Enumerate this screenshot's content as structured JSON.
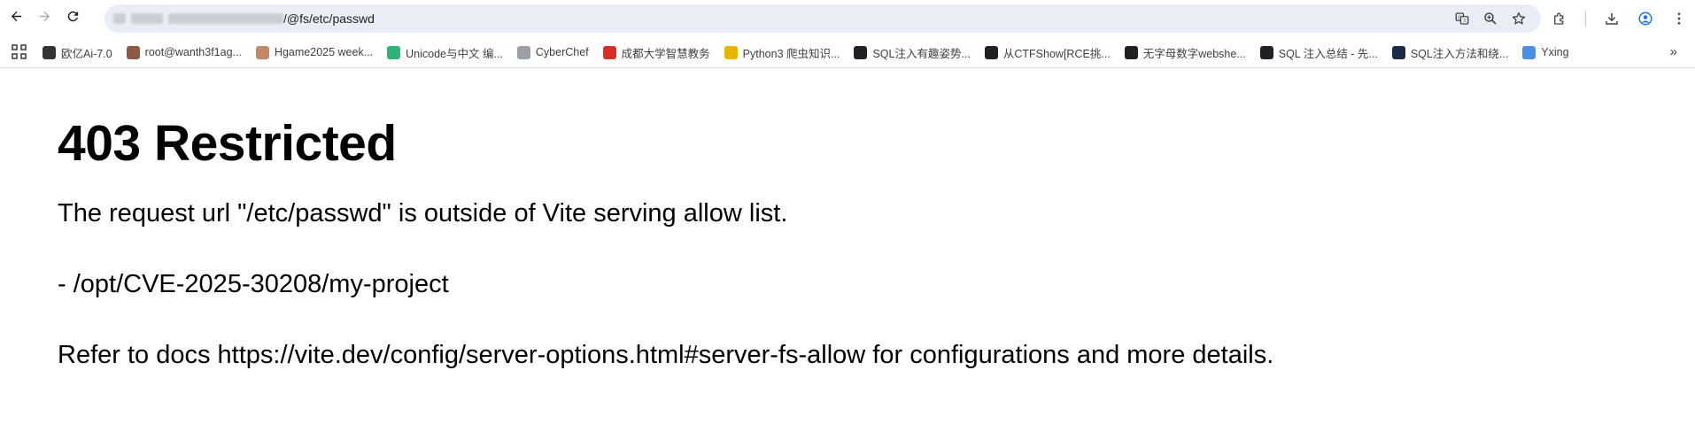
{
  "browser": {
    "url_path": "/@fs/etc/passwd",
    "nav": {
      "back_icon": "arrow-left-icon",
      "forward_icon": "arrow-right-icon",
      "reload_icon": "reload-icon"
    },
    "omnibox_icons": [
      "translate-icon",
      "zoom-icon",
      "star-icon"
    ],
    "toolbar_icons": [
      "extensions-icon",
      "download-icon",
      "profile-icon",
      "menu-icon"
    ]
  },
  "bookmarks": [
    {
      "label": "欧亿Ai-7.0",
      "icon_color": "#333333"
    },
    {
      "label": "root@wanth3f1ag...",
      "icon_color": "#8a5a44"
    },
    {
      "label": "Hgame2025 week...",
      "icon_color": "#c08a6a"
    },
    {
      "label": "Unicode与中文 编...",
      "icon_color": "#2db37a"
    },
    {
      "label": "CyberChef",
      "icon_color": "#9aa0a6"
    },
    {
      "label": "成都大学智慧教务",
      "icon_color": "#d93025"
    },
    {
      "label": "Python3 爬虫知识...",
      "icon_color": "#e8b400"
    },
    {
      "label": "SQL注入有趣姿势...",
      "icon_color": "#202124"
    },
    {
      "label": "从CTFShow[RCE挑...",
      "icon_color": "#202124"
    },
    {
      "label": "无字母数字webshe...",
      "icon_color": "#202124"
    },
    {
      "label": "SQL 注入总结 - 先...",
      "icon_color": "#202124"
    },
    {
      "label": "SQL注入方法和绕...",
      "icon_color": "#1b2a4a"
    },
    {
      "label": "Yxing",
      "icon_color": "#4a8fe7"
    }
  ],
  "bookmarks_more": "»",
  "page": {
    "title": "403 Restricted",
    "message": "The request url \"/etc/passwd\" is outside of Vite serving allow list.",
    "allow_item": "- /opt/CVE-2025-30208/my-project",
    "docs": "Refer to docs https://vite.dev/config/server-options.html#server-fs-allow for configurations and more details."
  }
}
